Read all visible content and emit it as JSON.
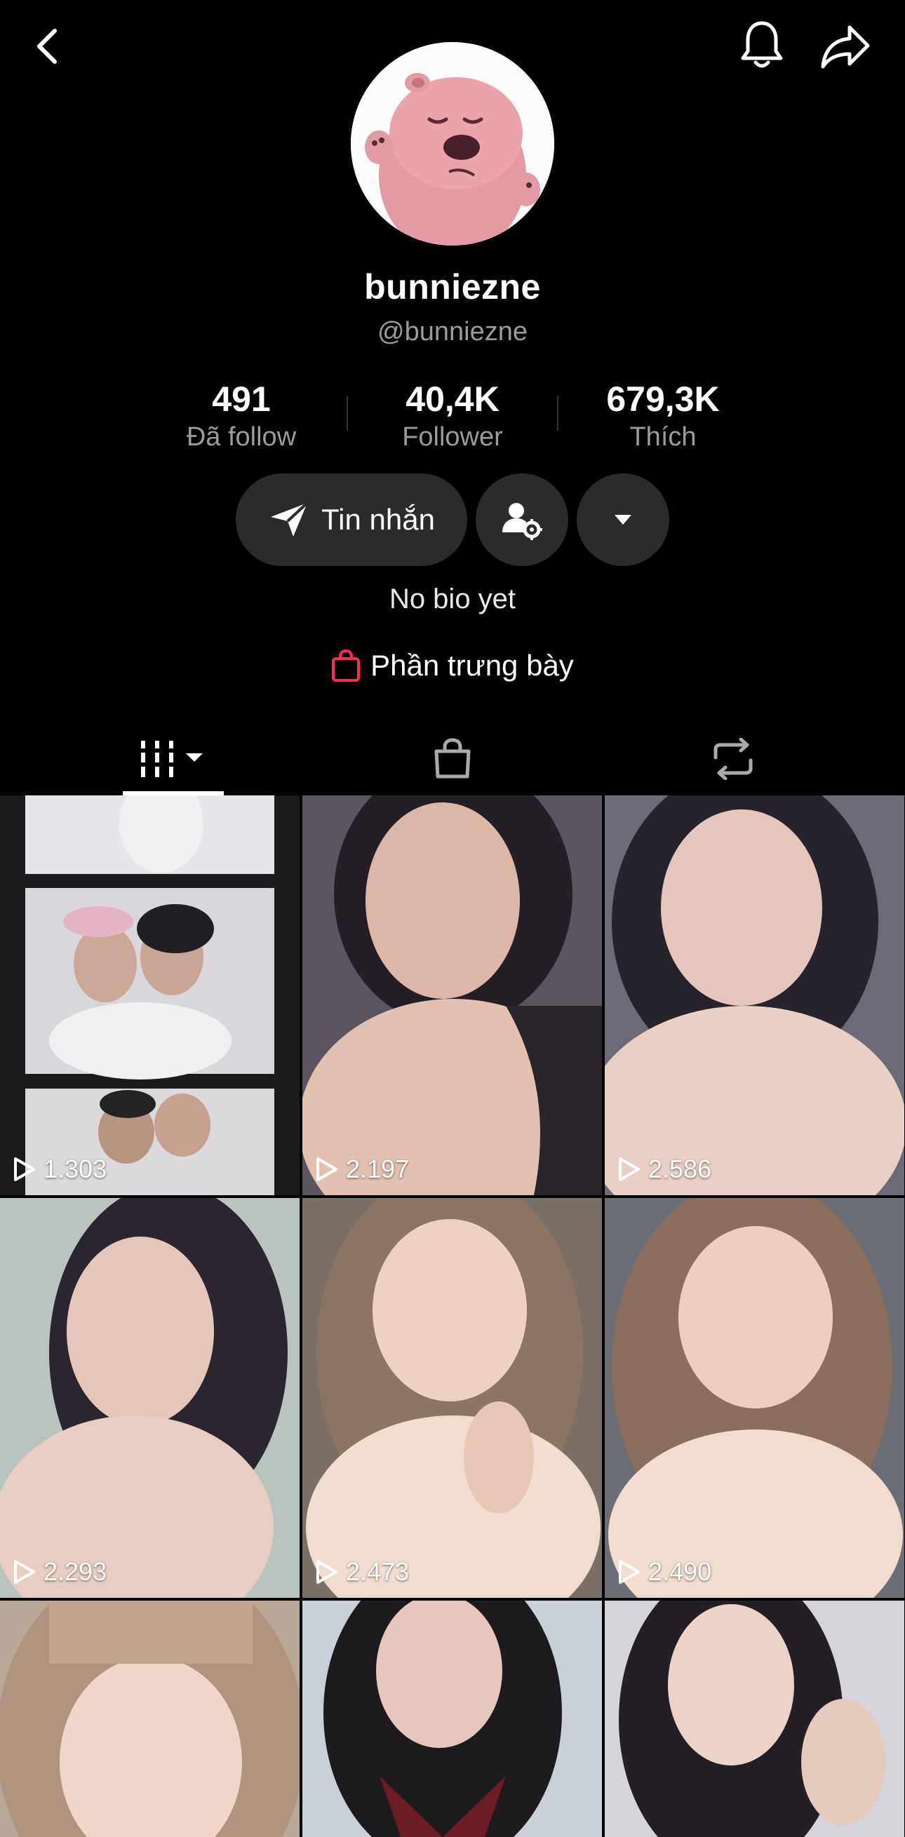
{
  "header": {
    "back_icon": "chevron-left-icon",
    "bell_icon": "bell-icon",
    "share_icon": "share-arrow-icon"
  },
  "profile": {
    "display_name": "bunniezne",
    "username": "@bunniezne",
    "bio": "No bio yet",
    "avatar_icon": "cartoon-beaver-avatar"
  },
  "stats": [
    {
      "value": "491",
      "label": "Đã follow"
    },
    {
      "value": "40,4K",
      "label": "Follower"
    },
    {
      "value": "679,3K",
      "label": "Thích"
    }
  ],
  "actions": {
    "message_label": "Tin nhắn",
    "message_icon": "send-icon",
    "friend_icon": "user-gear-icon",
    "more_icon": "caret-down-icon"
  },
  "showcase": {
    "label": "Phần trưng bày",
    "icon": "shopping-bag-icon",
    "accent": "#fe2c55"
  },
  "tabs": [
    {
      "name": "videos",
      "icon": "grid-icon",
      "active": true
    },
    {
      "name": "shop",
      "icon": "bag-icon",
      "active": false
    },
    {
      "name": "reposts",
      "icon": "repost-icon",
      "active": false
    }
  ],
  "videos": [
    {
      "plays": "1.303"
    },
    {
      "plays": "2.197"
    },
    {
      "plays": "2.586"
    },
    {
      "plays": "2.293"
    },
    {
      "plays": "2.473"
    },
    {
      "plays": "2.490"
    },
    {
      "plays": ""
    },
    {
      "plays": ""
    },
    {
      "plays": ""
    }
  ]
}
